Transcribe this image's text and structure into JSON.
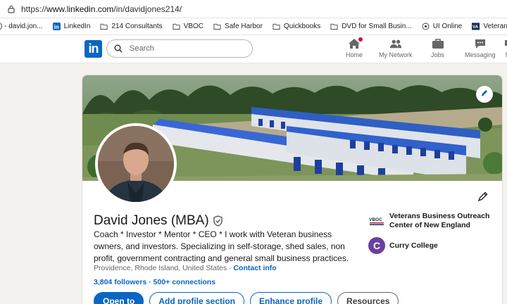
{
  "browser": {
    "url_prefix": "https://",
    "url_host": "www.linkedin.com",
    "url_path": "/in/davidjones214/"
  },
  "bookmarks": [
    {
      "label": ") - david.jon...",
      "icon": "tab-fragment-icon"
    },
    {
      "label": "LinkedIn",
      "icon": "linkedin-icon"
    },
    {
      "label": "214 Consultants",
      "icon": "folder-icon"
    },
    {
      "label": "VBOC",
      "icon": "folder-icon"
    },
    {
      "label": "Safe Harbor",
      "icon": "folder-icon"
    },
    {
      "label": "Quickbooks",
      "icon": "folder-icon"
    },
    {
      "label": "DVD for Small Busin...",
      "icon": "folder-icon"
    },
    {
      "label": "UI Online",
      "icon": "globe-icon"
    },
    {
      "label": "Veterans Affairs Hea...",
      "icon": "va-icon"
    }
  ],
  "nav": {
    "logo": "in",
    "search_placeholder": "Search",
    "items": [
      {
        "label": "Home",
        "icon": "home-icon"
      },
      {
        "label": "My Network",
        "icon": "network-icon"
      },
      {
        "label": "Jobs",
        "icon": "briefcase-icon"
      },
      {
        "label": "Messaging",
        "icon": "messaging-icon"
      },
      {
        "label": "N",
        "icon": "notifications-icon"
      }
    ]
  },
  "profile": {
    "name": "David Jones (MBA)",
    "headline": "Coach * Investor * Mentor * CEO * I work with Veteran business owners, and investors. Specializing in self-storage, shed sales, non profit, government contracting and general small business practices.",
    "location": "Providence, Rhode Island, United States",
    "separator": " · ",
    "contact_info": "Contact info",
    "followers": "3,804 followers",
    "dot": " · ",
    "connections": "500+ connections"
  },
  "orgs": [
    {
      "name": "Veterans Business Outreach Center of New England",
      "logo_text": "VBOC"
    },
    {
      "name": "Curry College",
      "logo_text": "C"
    }
  ],
  "actions": {
    "open_to": "Open to",
    "add_section": "Add profile section",
    "enhance": "Enhance profile",
    "resources": "Resources"
  },
  "colors": {
    "brand": "#0a66c2",
    "notification": "#cb112d",
    "curry": "#6b3fa0"
  }
}
